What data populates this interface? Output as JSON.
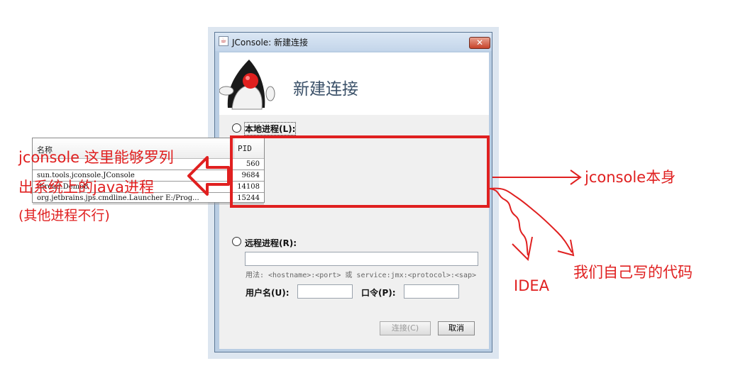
{
  "window": {
    "title": "JConsole: 新建连接",
    "close_glyph": "✕",
    "banner_title": "新建连接"
  },
  "local": {
    "label": "本地进程(L):",
    "columns": [
      "名称",
      "PID"
    ],
    "rows": [
      {
        "name": "",
        "pid": "560"
      },
      {
        "name": "sun.tools.jconsole.JConsole",
        "pid": "9684"
      },
      {
        "name": "thread.Demo8",
        "pid": "14108"
      },
      {
        "name": "org.jetbrains.jps.cmdline.Launcher E:/Prog...",
        "pid": "15244"
      }
    ]
  },
  "remote": {
    "label": "远程进程(R):",
    "value": "",
    "hint": "用法: <hostname>:<port> 或 service:jmx:<protocol>:<sap>"
  },
  "credentials": {
    "username_label": "用户名(U):",
    "username_value": "",
    "password_label": "口令(P):",
    "password_value": ""
  },
  "buttons": {
    "connect": "连接(C)",
    "cancel": "取消"
  },
  "annotations": {
    "left_line1": "jconsole 这里能够罗列",
    "left_line2": "出系统上的java进程",
    "left_line3": "(其他进程不行)",
    "jconsole_self": "jconsole本身",
    "idea": "IDEA",
    "our_code": "我们自己写的代码",
    "color": "#e02020"
  }
}
